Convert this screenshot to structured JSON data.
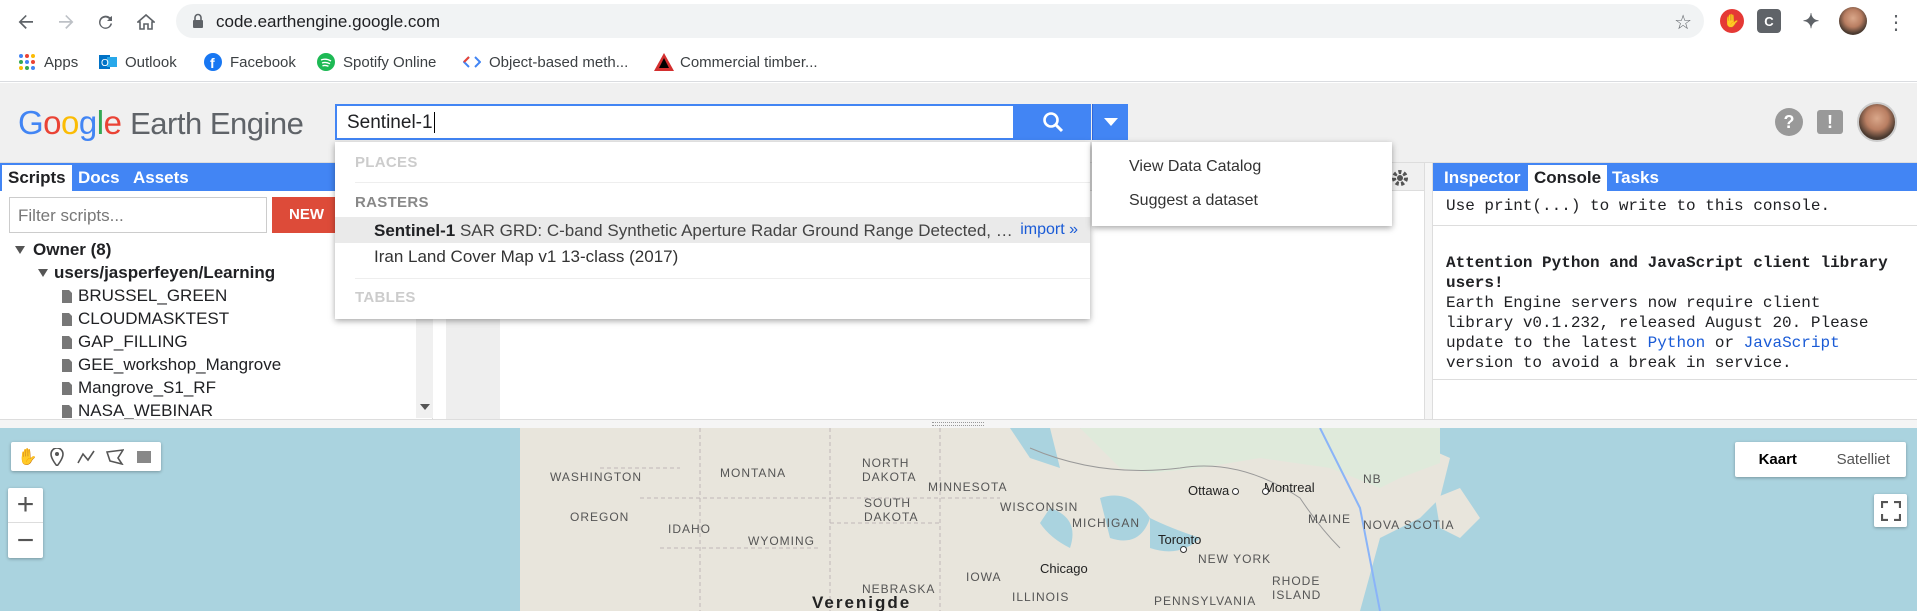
{
  "browser": {
    "url": "code.earthengine.google.com",
    "bookmarks": [
      {
        "label": "Apps",
        "icon": "apps-grid-icon"
      },
      {
        "label": "Outlook",
        "icon": "outlook-icon"
      },
      {
        "label": "Facebook",
        "icon": "facebook-icon"
      },
      {
        "label": "Spotify Online",
        "icon": "spotify-icon"
      },
      {
        "label": "Object-based meth...",
        "icon": "code-icon"
      },
      {
        "label": "Commercial timber...",
        "icon": "triangle-icon"
      }
    ]
  },
  "header": {
    "logo_google": "Google",
    "logo_ee": "Earth Engine",
    "search_value": "Sentinel-1"
  },
  "search_dropdown": {
    "sections": {
      "places": "PLACES",
      "rasters": "RASTERS",
      "tables": "TABLES"
    },
    "results": [
      {
        "bold": "Sentinel-1",
        "rest": " SAR GRD: C-band Synthetic Aperture Radar Ground Range Detected, …",
        "action": "import »"
      },
      {
        "bold": "",
        "rest": "Iran Land Cover Map v1 13-class (2017)",
        "action": ""
      }
    ]
  },
  "search_menu": {
    "items": [
      "View Data Catalog",
      "Suggest a dataset"
    ]
  },
  "left_tabs": [
    "Scripts",
    "Docs",
    "Assets"
  ],
  "right_tabs": [
    "Inspector",
    "Console",
    "Tasks"
  ],
  "scripts": {
    "filter_placeholder": "Filter scripts...",
    "new_label": "NEW",
    "owner": "Owner",
    "owner_count": "(8)",
    "folder": "users/jasperfeyen/Learning",
    "files": [
      "BRUSSEL_GREEN",
      "CLOUDMASKTEST",
      "GAP_FILLING",
      "GEE_workshop_Mangrove",
      "Mangrove_S1_RF",
      "NASA_WEBINAR"
    ]
  },
  "console": {
    "line1": "Use print(...) to write to this console.",
    "warn_title": "Attention Python and JavaScript client library users!",
    "warn_1": "Earth Engine servers now require client",
    "warn_2": "library v0.1.232, released August 20. Please",
    "warn_3a": "update to the latest ",
    "warn_python": "Python",
    "warn_or": " or ",
    "warn_js": "JavaScript",
    "warn_4": "version to avoid a break in service."
  },
  "map": {
    "maptype": [
      "Kaart",
      "Satelliet"
    ],
    "labels": [
      {
        "text": "WASHINGTON"
      },
      {
        "text": "MONTANA"
      },
      {
        "text": "NORTH"
      },
      {
        "text": "DAKOTA"
      },
      {
        "text": "MINNESOTA"
      },
      {
        "text": "OREGON"
      },
      {
        "text": "IDAHO"
      },
      {
        "text": "WYOMING"
      },
      {
        "text": "SOUTH"
      },
      {
        "text": "DAKOTA"
      },
      {
        "text": "WISCONSIN"
      },
      {
        "text": "MICHIGAN"
      },
      {
        "text": "IOWA"
      },
      {
        "text": "NEBRASKA"
      },
      {
        "text": "ILLINOIS"
      },
      {
        "text": "NEW YORK"
      },
      {
        "text": "MAINE"
      },
      {
        "text": "NB"
      },
      {
        "text": "NOVA SCOTIA"
      },
      {
        "text": "RHODE"
      },
      {
        "text": "ISLAND"
      },
      {
        "text": "PENNSYLVANIA"
      }
    ],
    "cities": [
      "Ottawa",
      "Montreal",
      "Toronto",
      "Chicago",
      "Verenigde"
    ]
  }
}
